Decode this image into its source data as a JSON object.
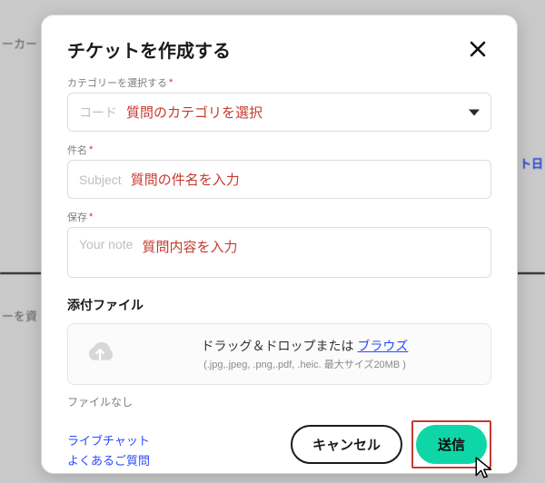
{
  "background": {
    "left1": "ーカー",
    "left2": "ーを資",
    "right1": "ト日"
  },
  "modal": {
    "title": "チケットを作成する",
    "category": {
      "label": "カテゴリーを選択する",
      "placeholder": "コード",
      "hint": "質問のカテゴリを選択"
    },
    "subject": {
      "label": "件名",
      "placeholder": "Subject",
      "hint": "質問の件名を入力"
    },
    "note": {
      "label": "保存",
      "placeholder": "Your note",
      "hint": "質問内容を入力"
    },
    "attachment": {
      "section_title": "添付ファイル",
      "drag_text": "ドラッグ＆ドロップまたは ",
      "browse": "ブラウズ",
      "formats": "(.jpg,.jpeg, .png,.pdf, .heic. 最大サイズ20MB )",
      "no_file": "ファイルなし"
    },
    "links": {
      "live_chat": "ライブチャット",
      "faq": "よくあるご質問"
    },
    "buttons": {
      "cancel": "キャンセル",
      "submit": "送信"
    },
    "required_mark": "*"
  }
}
